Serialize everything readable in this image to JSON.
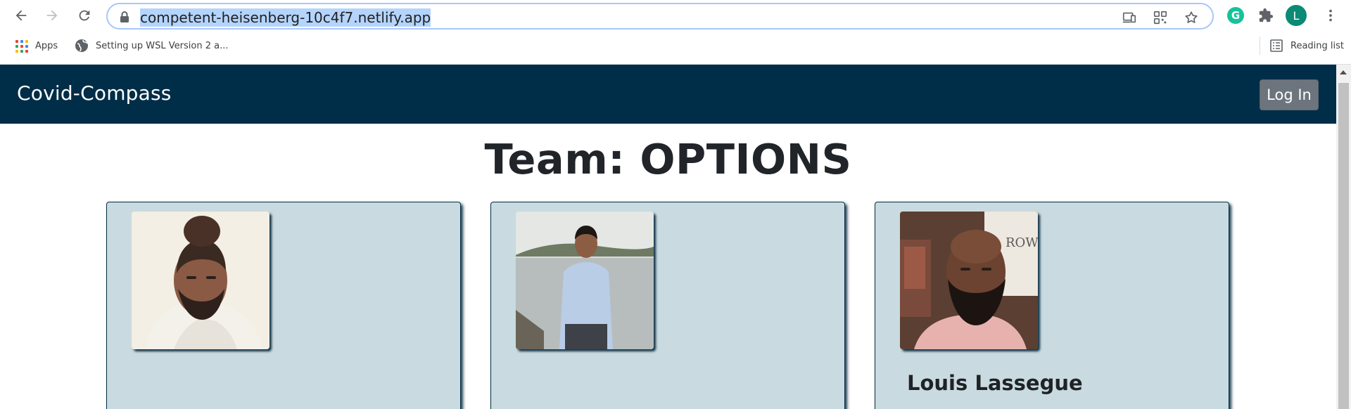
{
  "browser": {
    "url": "competent-heisenberg-10c4f7.netlify.app",
    "profile_initial": "L",
    "extension_initial": "G",
    "bookmarks": [
      {
        "label": "Apps",
        "icon": "apps-grid-icon"
      },
      {
        "label": "Setting up WSL Version 2 a...",
        "icon": "globe-icon"
      }
    ],
    "reading_list_label": "Reading list"
  },
  "navbar": {
    "brand": "Covid-Compass",
    "login_label": "Log In",
    "background": "#002d47"
  },
  "main": {
    "title": "Team: OPTIONS",
    "members": [
      {
        "name": "",
        "photo": "member-photo-1"
      },
      {
        "name": "",
        "photo": "member-photo-2"
      },
      {
        "name": "Louis Lassegue",
        "photo": "member-photo-3"
      }
    ]
  },
  "colors": {
    "card_background": "#c9dbe0",
    "login_button": "#6c757d",
    "omnibox_border": "#a8c7fa"
  }
}
